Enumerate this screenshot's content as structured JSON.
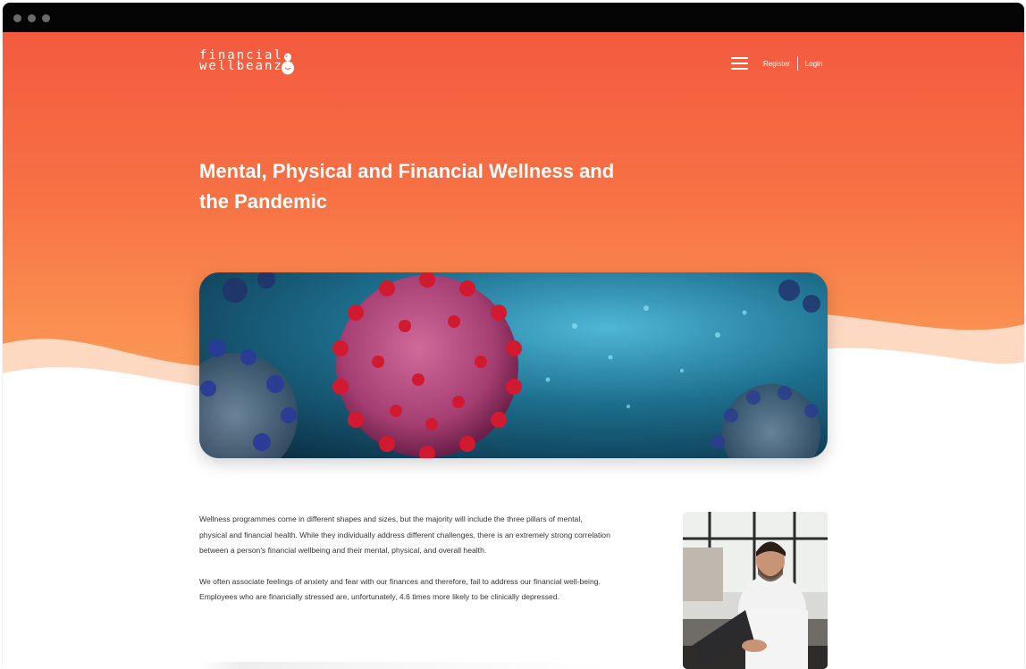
{
  "brand": {
    "logo_line1": "financial",
    "logo_line2": "wellbeanz",
    "logo_icon": "bean-mascot-icon"
  },
  "nav": {
    "menu_icon": "hamburger-menu-icon",
    "register_label": "Register",
    "login_label": "Login"
  },
  "hero": {
    "title": "Mental, Physical and Financial Wellness and the Pandemic",
    "image_alt": "coronavirus-illustration"
  },
  "article": {
    "paragraphs": [
      "Wellness programmes come in different shapes and sizes, but the majority will include the three pillars of mental, physical and financial health. While they individually address different challenges, there is an extremely strong correlation between a person's financial wellbeing and their mental, physical, and overall health.",
      "We often associate feelings of anxiety and fear with our finances and therefore, fail to address our financial well-being. Employees who are financially stressed are, unfortunately, 4.6 times more likely to be clinically depressed."
    ],
    "side_image": "man-working-on-laptop-photo"
  },
  "colors": {
    "hero_top": "#f45a3f",
    "hero_bottom": "#fb9a57",
    "wave_light": "#fde2d2",
    "titlebar": "#050505"
  }
}
